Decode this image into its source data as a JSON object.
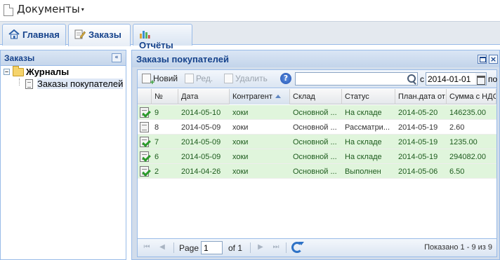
{
  "app": {
    "title": "Документы"
  },
  "tabs": [
    {
      "label": "Главная",
      "icon": "home-icon"
    },
    {
      "label": "Заказы",
      "icon": "edit-document-icon"
    },
    {
      "label": "Отчёты",
      "icon": "chart-icon"
    }
  ],
  "active_tab": "Заказы",
  "left_panel": {
    "title": "Заказы",
    "collapse_symbol": "«",
    "tree": {
      "root": {
        "label": "Журналы",
        "expander": "–"
      },
      "child": {
        "label": "Заказы покупателей"
      }
    }
  },
  "orders_window": {
    "title": "Заказы покупателей",
    "close_symbol": "×",
    "toolbar": {
      "new_label": "Новий",
      "edit_label": "Ред.",
      "delete_label": "Удалить",
      "help_symbol": "?",
      "search_value": "",
      "date_from_label": "с",
      "date_from_value": "2014-01-01",
      "date_to_label": "по"
    },
    "columns": [
      "№",
      "Дата",
      "Контрагент",
      "Склад",
      "Статус",
      "План.дата от",
      "Сумма с НДС"
    ],
    "sorted_column": "Контрагент",
    "rows": [
      {
        "num": "9",
        "date": "2014-05-10",
        "counterparty": "хоки",
        "warehouse": "Основной ...",
        "status": "На складе",
        "plan_date": "2014-05-20",
        "sum": "146235.00",
        "state": "done"
      },
      {
        "num": "8",
        "date": "2014-05-09",
        "counterparty": "хоки",
        "warehouse": "Основной ...",
        "status": "Рассматри...",
        "plan_date": "2014-05-19",
        "sum": "2.60",
        "state": "pending"
      },
      {
        "num": "7",
        "date": "2014-05-09",
        "counterparty": "хоки",
        "warehouse": "Основной ...",
        "status": "На складе",
        "plan_date": "2014-05-19",
        "sum": "1235.00",
        "state": "done"
      },
      {
        "num": "6",
        "date": "2014-05-09",
        "counterparty": "хоки",
        "warehouse": "Основной ...",
        "status": "На складе",
        "plan_date": "2014-05-19",
        "sum": "294082.00",
        "state": "done"
      },
      {
        "num": "2",
        "date": "2014-04-26",
        "counterparty": "хоки",
        "warehouse": "Основной ...",
        "status": "Выполнен",
        "plan_date": "2014-05-06",
        "sum": "6.50",
        "state": "done"
      }
    ],
    "paging": {
      "page_label": "Page",
      "page_value": "1",
      "of_label": "of 1",
      "display_info": "Показано 1 - 9 из 9"
    }
  },
  "colors": {
    "header_text": "#15428b",
    "done_row_bg": "#e0f5dc",
    "done_row_text": "#1e5c1e",
    "panel_border": "#99bbe8"
  }
}
